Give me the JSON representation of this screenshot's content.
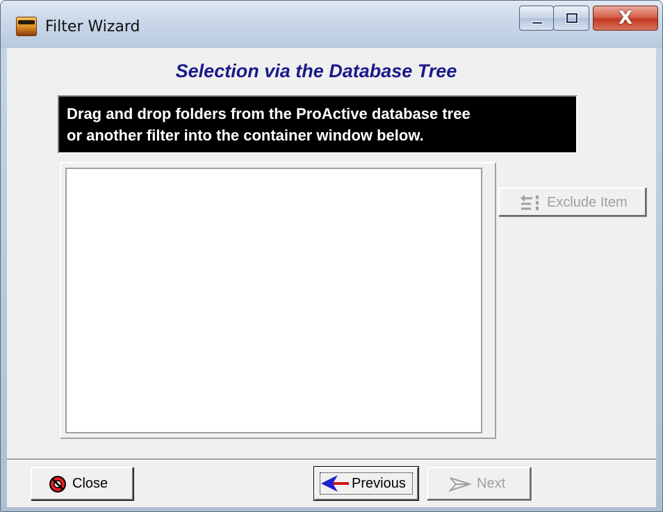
{
  "window": {
    "title": "Filter Wizard",
    "controls": {
      "minimize_icon": "minimize-icon",
      "maximize_icon": "maximize-icon",
      "close_label": "X"
    }
  },
  "page": {
    "heading": "Selection via the Database Tree",
    "instructions": [
      "Drag and drop folders from the ProActive database tree",
      "or another filter into the container window below."
    ]
  },
  "side_actions": {
    "exclude_label": "Exclude Item",
    "exclude_icon": "exclude-item-icon",
    "exclude_enabled": false
  },
  "footer": {
    "close_label": "Close",
    "close_icon": "stop-icon",
    "previous_label": "Previous",
    "previous_icon": "back-arrow-icon",
    "next_label": "Next",
    "next_icon": "forward-arrow-icon",
    "next_enabled": false
  },
  "colors": {
    "heading": "#1a1a8c",
    "info_background": "#000000",
    "info_text": "#ffffff",
    "close_button": "#c2391f",
    "previous_arrow": "#1f1fd1"
  }
}
